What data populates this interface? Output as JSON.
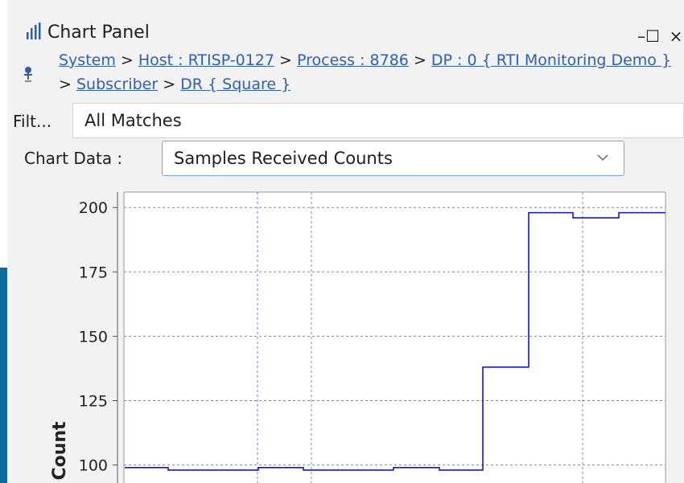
{
  "window": {
    "title": "Chart Panel",
    "controls": {
      "minimize": "–",
      "maximize": "☐",
      "close": "×"
    }
  },
  "breadcrumb": {
    "items": [
      {
        "label": "System",
        "link": true
      },
      {
        "label": ">",
        "link": false
      },
      {
        "label": "Host : RTISP-0127",
        "link": true
      },
      {
        "label": ">",
        "link": false
      },
      {
        "label": "Process : 8786",
        "link": true
      },
      {
        "label": ">",
        "link": false
      },
      {
        "label": "DP : 0 { RTI Monitoring Demo }",
        "link": true
      },
      {
        "label": ">",
        "link": false
      },
      {
        "label": "Subscriber",
        "link": true
      },
      {
        "label": ">",
        "link": false
      },
      {
        "label": "DR { Square }",
        "link": true
      }
    ]
  },
  "filter": {
    "label": "Filt...",
    "value": "All Matches"
  },
  "chart_selector": {
    "label": "Chart Data :",
    "value": "Samples Received Counts"
  },
  "chart_data": {
    "type": "line",
    "step": true,
    "ylabel": "Count",
    "ylim_visible": [
      93,
      206
    ],
    "yticks": [
      100,
      125,
      150,
      175,
      200
    ],
    "grid": true,
    "series": [
      {
        "color": "#1414d6",
        "points": [
          [
            0,
            99
          ],
          [
            1,
            98
          ],
          [
            2,
            99
          ],
          [
            3,
            98
          ],
          [
            4,
            99
          ],
          [
            5,
            98
          ],
          [
            6,
            138
          ],
          [
            7,
            198
          ],
          [
            8,
            196
          ],
          [
            9,
            198
          ],
          [
            10,
            198
          ]
        ]
      }
    ]
  },
  "colors": {
    "accent_blue": "#0e6aa3",
    "link": "#2f5fb3",
    "series": "#1414d6"
  }
}
